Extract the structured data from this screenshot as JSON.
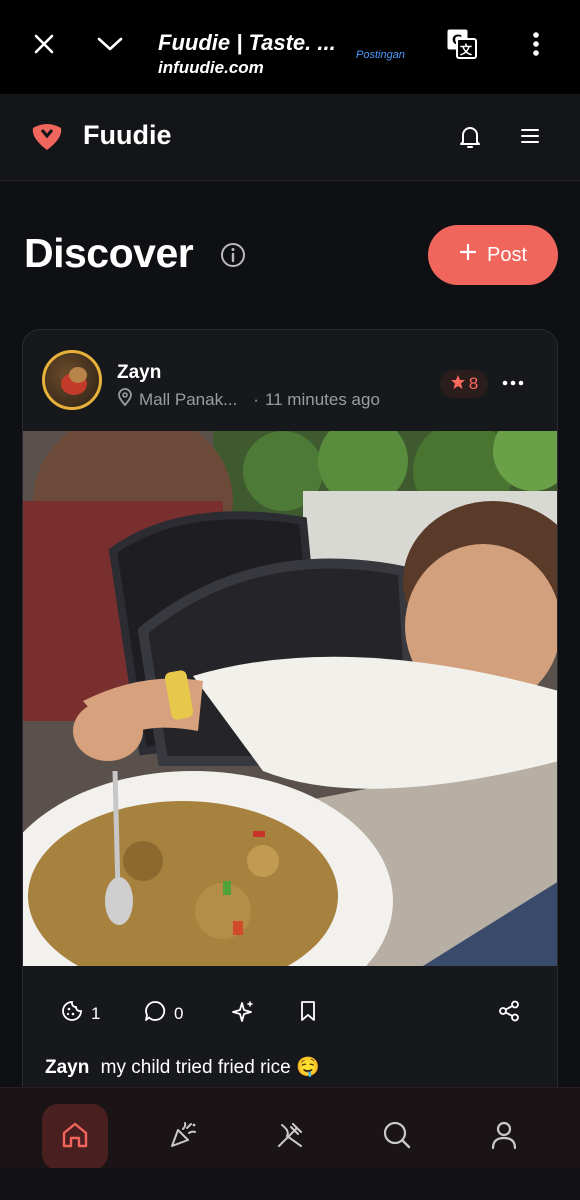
{
  "browser": {
    "title": "Fuudie | Taste. ...",
    "domain": "infuudie.com",
    "badge": "Postingan"
  },
  "app": {
    "name": "Fuudie",
    "accent": "#f0665d"
  },
  "discover": {
    "title": "Discover",
    "post_button": "Post"
  },
  "post": {
    "user": "Zayn",
    "location": "Mall Panak...",
    "time": "11 minutes ago",
    "rating": "8",
    "cookies": "1",
    "comments": "0",
    "caption_user": "Zayn",
    "caption_text": "my child tried fried rice 🤤"
  },
  "icons": {
    "close": "close-icon",
    "collapse": "chevron-down-icon",
    "translate": "translate-icon",
    "kebab": "kebab-icon",
    "bell": "bell-icon",
    "menu": "hamburger-icon",
    "info": "info-icon",
    "plus": "plus-icon",
    "pin": "location-pin-icon",
    "star": "star-icon",
    "more": "more-horizontal-icon",
    "cookie": "cookie-icon",
    "comment": "comment-icon",
    "sparkle": "sparkle-icon",
    "bookmark": "bookmark-icon",
    "share": "share-icon",
    "home": "home-icon",
    "party": "party-popper-icon",
    "utensils": "utensils-icon",
    "search": "search-icon",
    "profile": "user-icon"
  }
}
